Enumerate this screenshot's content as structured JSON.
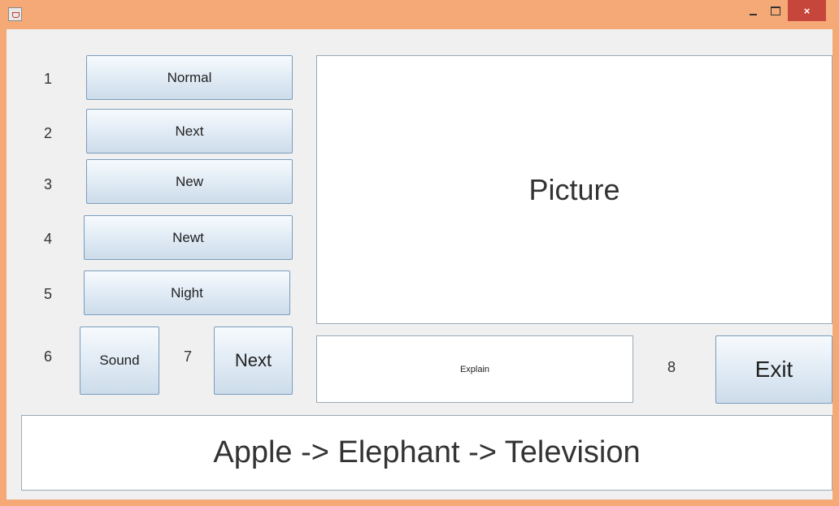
{
  "window": {
    "close_glyph": "×"
  },
  "rows": [
    {
      "number": "1",
      "label": "Normal"
    },
    {
      "number": "2",
      "label": "Next"
    },
    {
      "number": "3",
      "label": "New"
    },
    {
      "number": "4",
      "label": "Newt"
    },
    {
      "number": "5",
      "label": "Night"
    }
  ],
  "bottom": {
    "sound_number": "6",
    "sound_label": "Sound",
    "next_number": "7",
    "next_label": "Next",
    "exit_number": "8",
    "exit_label": "Exit"
  },
  "picture": {
    "text": "Picture"
  },
  "explain": {
    "text": "Explain"
  },
  "sequence": {
    "text": "Apple -> Elephant -> Television"
  }
}
